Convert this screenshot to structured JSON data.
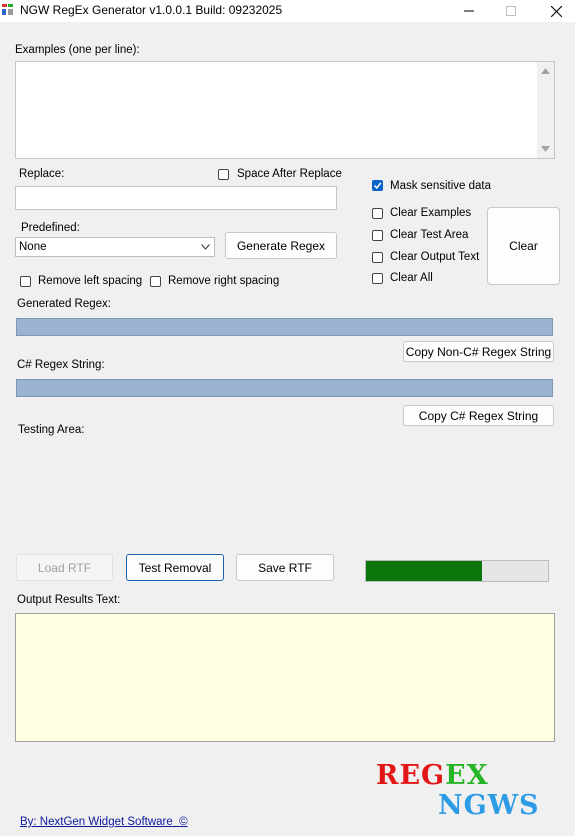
{
  "window": {
    "title": "NGW RegEx Generator v1.0.0.1 Build: 09232025"
  },
  "examples": {
    "label": "Examples (one per line):",
    "value": ""
  },
  "replace": {
    "label": "Replace:",
    "value": "",
    "space_after_label": "Space After Replace",
    "space_after_checked": false
  },
  "options": {
    "mask_sensitive": {
      "label": "Mask sensitive data",
      "checked": true
    },
    "clear_examples": {
      "label": "Clear Examples",
      "checked": false
    },
    "clear_test_area": {
      "label": "Clear Test Area",
      "checked": false
    },
    "clear_output_text": {
      "label": "Clear Output Text",
      "checked": false
    },
    "clear_all": {
      "label": "Clear All",
      "checked": false
    },
    "clear_button": "Clear"
  },
  "predefined": {
    "label": "Predefined:",
    "selected": "None",
    "generate_button": "Generate Regex"
  },
  "spacing": {
    "remove_left": "Remove left spacing",
    "remove_right": "Remove right spacing"
  },
  "generated": {
    "label": "Generated Regex:",
    "value": "",
    "copy_button": "Copy Non-C# Regex String"
  },
  "csharp": {
    "label": "C# Regex String:",
    "value": "",
    "copy_button": "Copy C# Regex String"
  },
  "testing": {
    "label": "Testing Area:"
  },
  "actions": {
    "load_rtf": "Load RTF",
    "test_removal": "Test Removal",
    "save_rtf": "Save RTF",
    "progress": 0.64
  },
  "output": {
    "label": "Output Results Text:",
    "value": ""
  },
  "footer": {
    "credit": "By: NextGen Widget Software",
    "copyright_symbol": "©",
    "logo_line1_letters": [
      "R",
      "E",
      "G",
      "E",
      "X"
    ],
    "logo_line2": "NGWS"
  },
  "colors": {
    "progress_fill": "#0c750c",
    "output_bg": "#ffffe1",
    "regex_bar": "#9bb4d2",
    "link": "#0c1a9c",
    "logo_red": "#e21616",
    "logo_green": "#26b526",
    "logo_blue": "#2e9be5"
  }
}
